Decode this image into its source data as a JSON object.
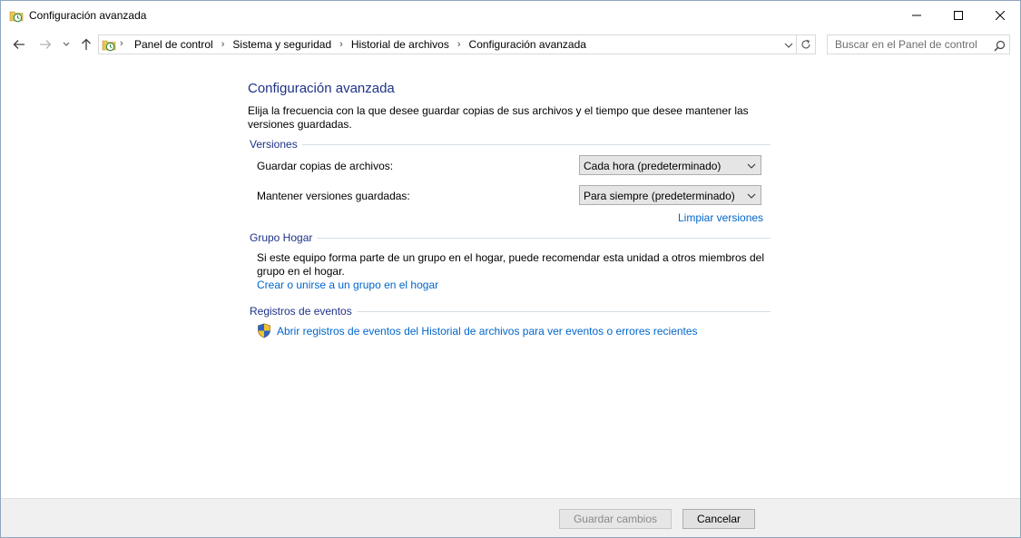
{
  "window": {
    "title": "Configuración avanzada"
  },
  "nav": {
    "breadcrumbs": [
      "Panel de control",
      "Sistema y seguridad",
      "Historial de archivos",
      "Configuración avanzada"
    ],
    "search_placeholder": "Buscar en el Panel de control"
  },
  "main": {
    "title": "Configuración avanzada",
    "description": "Elija la frecuencia con la que desee guardar copias de sus archivos y el tiempo que desee mantener las versiones guardadas.",
    "versions": {
      "heading": "Versiones",
      "save_copies_label": "Guardar copias de archivos:",
      "save_copies_value": "Cada hora (predeterminado)",
      "keep_versions_label": "Mantener versiones guardadas:",
      "keep_versions_value": "Para siempre (predeterminado)",
      "clean_link": "Limpiar versiones"
    },
    "homegroup": {
      "heading": "Grupo Hogar",
      "description": "Si este equipo forma parte de un grupo en el hogar, puede recomendar esta unidad a otros miembros del grupo en el hogar.",
      "link": "Crear o unirse a un grupo en el hogar"
    },
    "events": {
      "heading": "Registros de eventos",
      "link": "Abrir registros de eventos del Historial de archivos para ver eventos o errores recientes"
    }
  },
  "footer": {
    "save_label": "Guardar cambios",
    "cancel_label": "Cancelar"
  },
  "icons": {
    "app": "file-history-icon",
    "shield": "uac-shield-icon"
  },
  "colors": {
    "heading_blue": "#1e3287",
    "link_blue": "#0066cc"
  }
}
